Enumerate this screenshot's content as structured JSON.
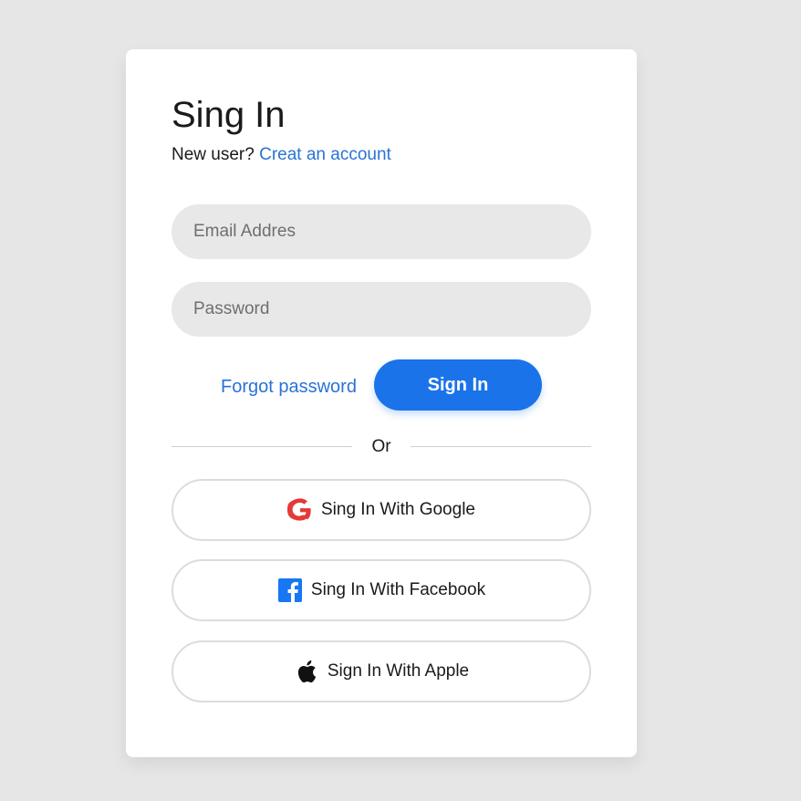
{
  "card": {
    "title": "Sing In",
    "subtitle_prefix": "New user?",
    "create_account_link": "Creat an account"
  },
  "form": {
    "email_placeholder": "Email Addres",
    "password_placeholder": "Password",
    "forgot_password": "Forgot password",
    "signin_button": "Sign In"
  },
  "divider": {
    "label": "Or"
  },
  "social": {
    "google": {
      "label": "Sing In With Google",
      "icon": "google-icon"
    },
    "facebook": {
      "label": "Sing In With Facebook",
      "icon": "facebook-icon"
    },
    "apple": {
      "label": "Sign In With Apple",
      "icon": "apple-icon"
    }
  },
  "colors": {
    "background": "#e6e6e6",
    "primary": "#1a73e8",
    "link": "#2a72d6",
    "field_bg": "#e8e8e8"
  }
}
